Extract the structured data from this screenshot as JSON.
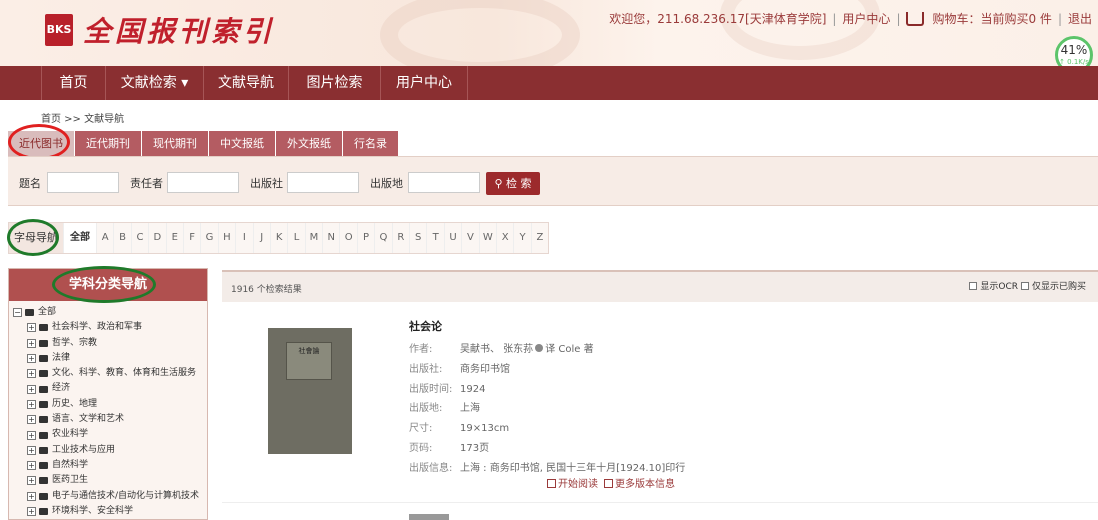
{
  "header": {
    "logo_text": "BKS",
    "site_title": "全国报刊索引",
    "welcome": "欢迎您，211.68.236.17[天津体育学院]",
    "user_center": "用户中心",
    "cart": "购物车：当前购买0 件",
    "logout": "退出",
    "speed_percent": "41%",
    "speed_rate": "↑ 0.1K/s"
  },
  "nav": {
    "items": [
      "首页",
      "文献检索 ▾",
      "文献导航",
      "图片检索",
      "用户中心"
    ]
  },
  "breadcrumb": "首页 >> 文献导航",
  "tabs": [
    "近代图书",
    "近代期刊",
    "现代期刊",
    "中文报纸",
    "外文报纸",
    "行名录"
  ],
  "search": {
    "labels": [
      "题名",
      "责任者",
      "出版社",
      "出版地"
    ],
    "button": "检 索"
  },
  "alpha_nav": {
    "label": "字母导航",
    "all": "全部",
    "letters": [
      "A",
      "B",
      "C",
      "D",
      "E",
      "F",
      "G",
      "H",
      "I",
      "J",
      "K",
      "L",
      "M",
      "N",
      "O",
      "P",
      "Q",
      "R",
      "S",
      "T",
      "U",
      "V",
      "W",
      "X",
      "Y",
      "Z"
    ]
  },
  "sidebar": {
    "title": "学科分类导航",
    "root": "全部",
    "items": [
      "社会科学、政治和军事",
      "哲学、宗教",
      "法律",
      "文化、科学、教育、体育和生活服务",
      "经济",
      "历史、地理",
      "语言、文学和艺术",
      "农业科学",
      "工业技术与应用",
      "自然科学",
      "医药卫生",
      "电子与通信技术/自动化与计算机技术",
      "环境科学、安全科学"
    ]
  },
  "results": {
    "count": "1916 个检索结果",
    "opt_ocr": "显示OCR",
    "opt_bought": "仅显示已购买"
  },
  "book": {
    "cover_text": "社會論",
    "title": "社会论",
    "author_key": "作者:",
    "author_val1": "吴献书、 张东荪",
    "author_val2": "译 Cole 著",
    "publisher_key": "出版社:",
    "publisher_val": "商务印书馆",
    "time_key": "出版时间:",
    "time_val": "1924",
    "place_key": "出版地:",
    "place_val": "上海",
    "size_key": "尺寸:",
    "size_val": "19×13cm",
    "pages_key": "页码:",
    "pages_val": "173页",
    "info_key": "出版信息:",
    "info_val": "上海 : 商务印书馆, 民国十三年十月[1924.10]印行",
    "read": "开始阅读",
    "more": "更多版本信息"
  }
}
